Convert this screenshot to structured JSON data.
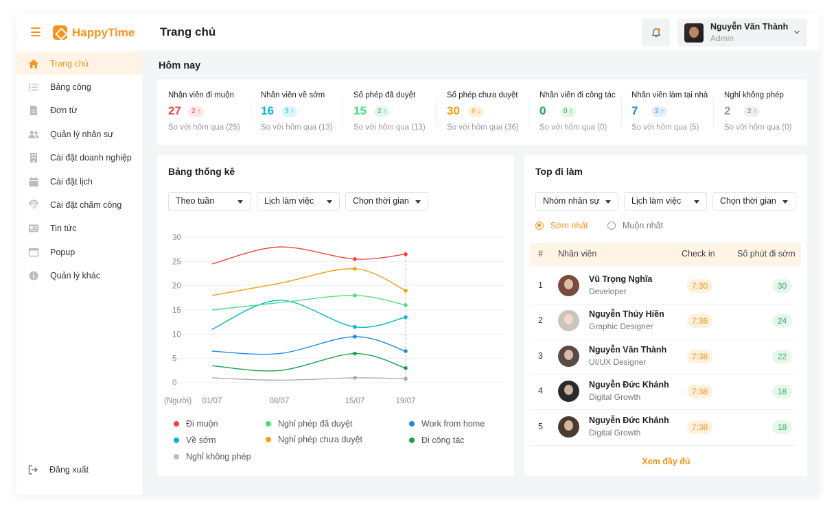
{
  "app": {
    "name": "HappyTime",
    "page_title": "Trang chủ"
  },
  "user": {
    "name": "Nguyễn Văn Thành",
    "role": "Admin"
  },
  "sidebar": {
    "items": [
      {
        "label": "Trang chủ",
        "icon": "home-icon",
        "active": true
      },
      {
        "label": "Bảng công",
        "icon": "list-icon"
      },
      {
        "label": "Đơn từ",
        "icon": "document-icon"
      },
      {
        "label": "Quản lý nhân sự",
        "icon": "users-icon"
      },
      {
        "label": "Cài đặt doanh nghiệp",
        "icon": "building-icon"
      },
      {
        "label": "Cài đặt lịch",
        "icon": "calendar-icon"
      },
      {
        "label": "Cài đặt chấm công",
        "icon": "fingerprint-icon"
      },
      {
        "label": "Tin tức",
        "icon": "news-icon"
      },
      {
        "label": "Popup",
        "icon": "window-icon"
      },
      {
        "label": "Quản lý khác",
        "icon": "info-icon"
      }
    ],
    "logout_label": "Đăng xuất"
  },
  "today": {
    "title": "Hôm nay",
    "stats": [
      {
        "label": "Nhận viên đi muộn",
        "value": "27",
        "change": "2",
        "dir": "up",
        "compare": "So với hôm qua (25)",
        "color": "#ef4444"
      },
      {
        "label": "Nhân viên về sớm",
        "value": "16",
        "change": "3",
        "dir": "up",
        "compare": "So với hôm qua (13)",
        "color": "#06b6d4"
      },
      {
        "label": "Số phép đã duyệt",
        "value": "15",
        "change": "2",
        "dir": "up",
        "compare": "So với hôm qua (13)",
        "color": "#4ade80"
      },
      {
        "label": "Số phép chưa duyệt",
        "value": "30",
        "change": "6",
        "dir": "down",
        "compare": "So với hôm qua (36)",
        "color": "#f59e0b"
      },
      {
        "label": "Nhân viên đi công tác",
        "value": "0",
        "change": "0",
        "dir": "up",
        "compare": "So với hôm qua (0)",
        "color": "#16a34a"
      },
      {
        "label": "Nhân viên làm tại nhà",
        "value": "7",
        "change": "2",
        "dir": "up",
        "compare": "So với hôm qua (5)",
        "color": "#1e88e5"
      },
      {
        "label": "Nghỉ không phép",
        "value": "2",
        "change": "2",
        "dir": "up",
        "compare": "So với hôm qua (0)",
        "color": "#999999"
      }
    ]
  },
  "stats_card": {
    "title": "Bảng thống kê",
    "filters": [
      "Theo tuần",
      "Lịch làm việc",
      "Chọn thời gian"
    ]
  },
  "chart_data": {
    "type": "line",
    "x": [
      "01/07",
      "08/07",
      "15/07",
      "19/07"
    ],
    "xlabel": "(Người)",
    "ylim": [
      0,
      30
    ],
    "yticks": [
      "30",
      "25",
      "20",
      "15",
      "10",
      "5",
      "0"
    ],
    "grid": true,
    "legend_position": "bottom",
    "series": [
      {
        "name": "Đi muộn",
        "color": "#ef4444",
        "values": [
          24.5,
          28,
          25.5,
          26.5
        ]
      },
      {
        "name": "Về sớm",
        "color": "#06b6d4",
        "values": [
          11,
          17,
          11.5,
          13.5
        ]
      },
      {
        "name": "Nghỉ không phép",
        "color": "#aaaaaa",
        "values": [
          1,
          0.5,
          1,
          0.8
        ]
      },
      {
        "name": "Nghỉ phép đã duyệt",
        "color": "#4ade80",
        "values": [
          15,
          16.5,
          18,
          16
        ]
      },
      {
        "name": "Nghỉ phép chưa duyệt",
        "color": "#f59e0b",
        "values": [
          18,
          20.5,
          23.5,
          19
        ]
      },
      {
        "name": "Work from home",
        "color": "#1e88e5",
        "values": [
          6.5,
          6,
          9.5,
          6.5
        ]
      },
      {
        "name": "Đi công tác",
        "color": "#16a34a",
        "values": [
          3.5,
          2.5,
          6,
          3
        ]
      }
    ]
  },
  "top_card": {
    "title": "Top đi làm",
    "filters": [
      "Nhóm nhân sự",
      "Lịch làm việc",
      "Chọn thời gian"
    ],
    "radio": [
      "Sớm nhất",
      "Muộn nhất"
    ],
    "headers": {
      "num": "#",
      "employee": "Nhân viên",
      "checkin": "Check in",
      "early": "Số phút đi sớm"
    },
    "rows": [
      {
        "num": "1",
        "name": "Vũ Trọng Nghĩa",
        "role": "Developer",
        "checkin": "7:30",
        "early": "30",
        "avatar_color": "#7a4b3a"
      },
      {
        "num": "2",
        "name": "Nguyễn Thúy Hiền",
        "role": "Graphic Designer",
        "checkin": "7:36",
        "early": "24",
        "avatar_color": "#c9c4be"
      },
      {
        "num": "3",
        "name": "Nguyễn Văn Thành",
        "role": "UI/UX Designer",
        "checkin": "7:38",
        "early": "22",
        "avatar_color": "#5a4a44"
      },
      {
        "num": "4",
        "name": "Nguyễn Đức Khánh",
        "role": "Digital Growth",
        "checkin": "7:38",
        "early": "18",
        "avatar_color": "#2a2a2a"
      },
      {
        "num": "5",
        "name": "Nguyễn Đức Khánh",
        "role": "Digital Growth",
        "checkin": "7:38",
        "early": "18",
        "avatar_color": "#4a3a30"
      }
    ],
    "see_all": "Xem đầy đủ"
  }
}
